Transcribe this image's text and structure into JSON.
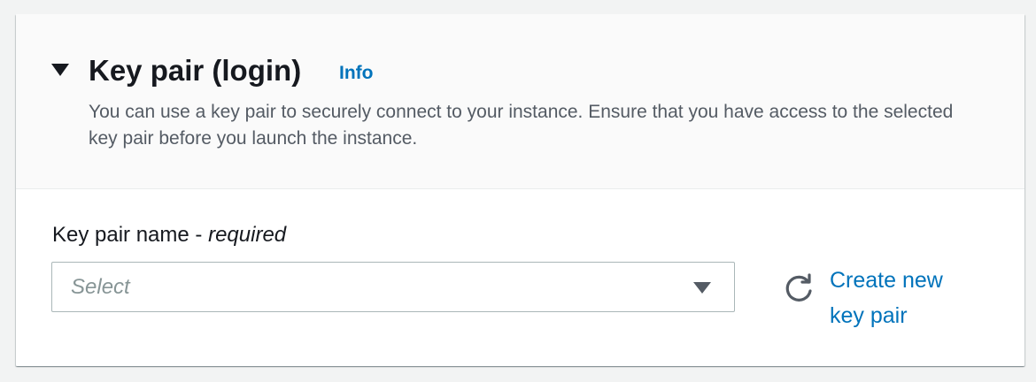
{
  "section": {
    "title": "Key pair (login)",
    "info_link": "Info",
    "description": "You can use a key pair to securely connect to your instance. Ensure that you have access to the selected key pair before you launch the instance.",
    "expanded_icon": "caret-down-icon"
  },
  "key_pair_field": {
    "label": "Key pair name - ",
    "label_required": "required",
    "placeholder": "Select",
    "dropdown_icon": "caret-down-icon"
  },
  "actions": {
    "refresh_icon": "refresh-icon",
    "create_new_label": "Create new key pair"
  },
  "colors": {
    "link": "#0073bb",
    "header_bg": "#fafafa",
    "page_bg": "#f2f3f3",
    "text": "#16191f",
    "secondary_text": "#545b64",
    "placeholder": "#879596",
    "border": "#aab7b8"
  }
}
